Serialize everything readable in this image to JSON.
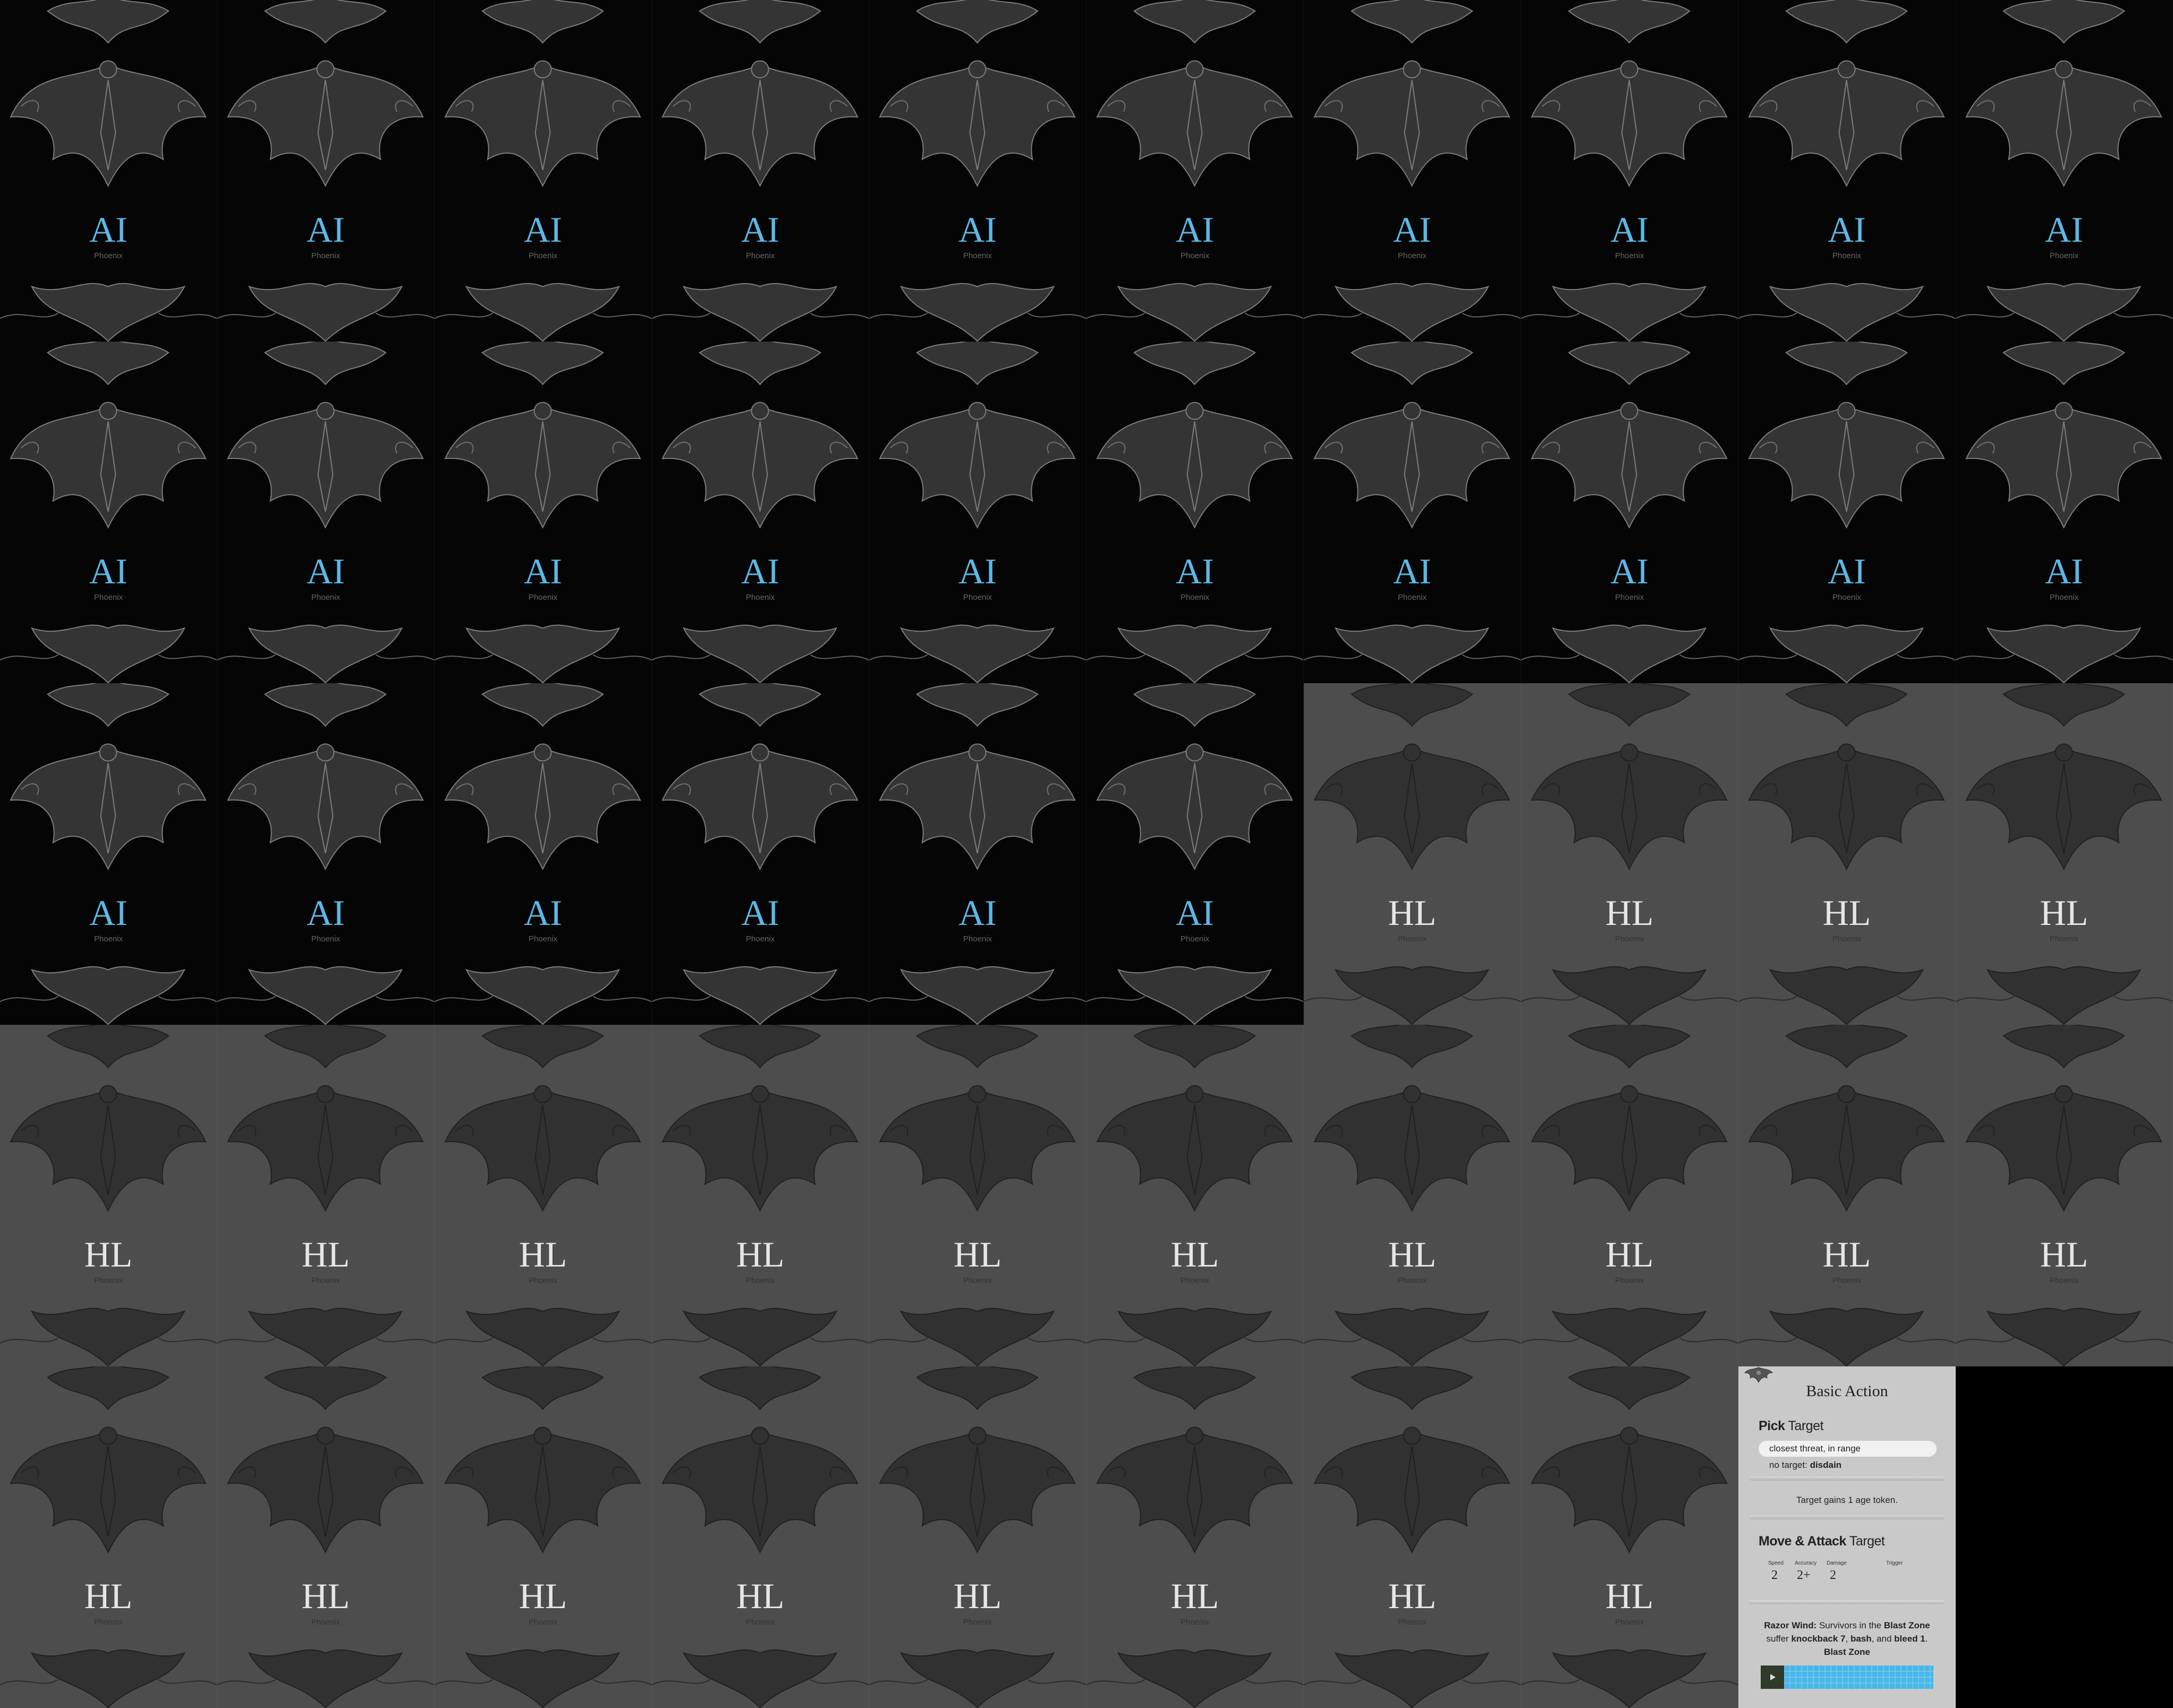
{
  "ai_card": {
    "code": "AI",
    "subtitle": "Phoenix",
    "accent_color": "#5bb8e6",
    "count": 26
  },
  "hl_card": {
    "code": "HL",
    "subtitle": "Phoenix",
    "count": 22
  },
  "basic_action": {
    "title": "Basic Action",
    "pick_target": {
      "heading_bold": "Pick",
      "heading_rest": " Target",
      "option_1": "closest threat, in range",
      "option_2_prefix": "no target: ",
      "option_2_bold": "disdain"
    },
    "effect": "Target gains 1 age token.",
    "move_attack": {
      "heading_bold": "Move & Attack",
      "heading_rest": " Target"
    },
    "stats": [
      {
        "label": "Speed",
        "value": "2"
      },
      {
        "label": "Accuracy",
        "value": "2+"
      },
      {
        "label": "Damage",
        "value": "2"
      },
      {
        "label": "Trigger",
        "value": ""
      }
    ],
    "razor_wind": {
      "name": "Razor Wind:",
      "text_1": " Survivors in the ",
      "zone_1": "Blast Zone",
      "text_2": " suffer ",
      "effect_1": "knockback 7",
      "text_3": ", ",
      "effect_2": "bash",
      "text_4": ", and ",
      "effect_3": "bleed 1",
      "text_5": ".",
      "zone_label": "Blast Zone"
    },
    "blast_grid_color": "#48b6e8"
  }
}
